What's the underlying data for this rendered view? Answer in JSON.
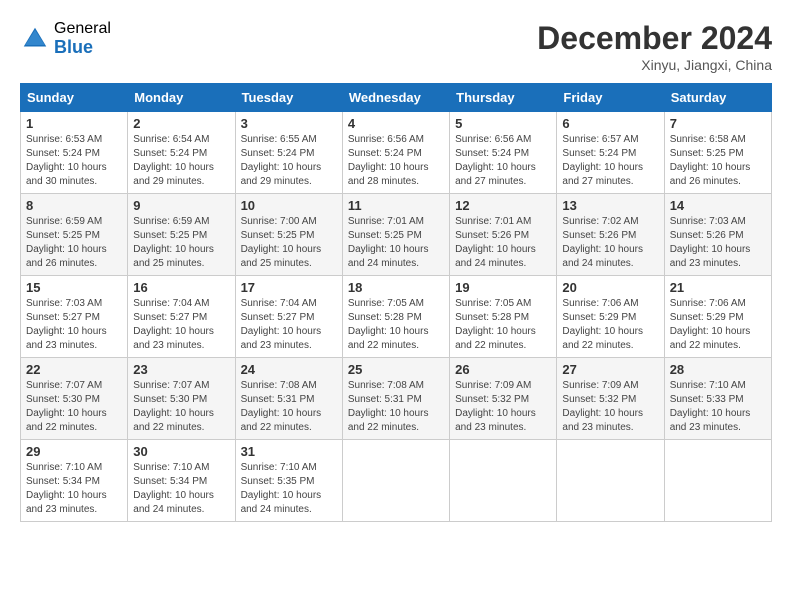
{
  "header": {
    "logo_general": "General",
    "logo_blue": "Blue",
    "title": "December 2024",
    "location": "Xinyu, Jiangxi, China"
  },
  "weekdays": [
    "Sunday",
    "Monday",
    "Tuesday",
    "Wednesday",
    "Thursday",
    "Friday",
    "Saturday"
  ],
  "weeks": [
    [
      {
        "day": "1",
        "sunrise": "6:53 AM",
        "sunset": "5:24 PM",
        "daylight": "10 hours and 30 minutes."
      },
      {
        "day": "2",
        "sunrise": "6:54 AM",
        "sunset": "5:24 PM",
        "daylight": "10 hours and 29 minutes."
      },
      {
        "day": "3",
        "sunrise": "6:55 AM",
        "sunset": "5:24 PM",
        "daylight": "10 hours and 29 minutes."
      },
      {
        "day": "4",
        "sunrise": "6:56 AM",
        "sunset": "5:24 PM",
        "daylight": "10 hours and 28 minutes."
      },
      {
        "day": "5",
        "sunrise": "6:56 AM",
        "sunset": "5:24 PM",
        "daylight": "10 hours and 27 minutes."
      },
      {
        "day": "6",
        "sunrise": "6:57 AM",
        "sunset": "5:24 PM",
        "daylight": "10 hours and 27 minutes."
      },
      {
        "day": "7",
        "sunrise": "6:58 AM",
        "sunset": "5:25 PM",
        "daylight": "10 hours and 26 minutes."
      }
    ],
    [
      {
        "day": "8",
        "sunrise": "6:59 AM",
        "sunset": "5:25 PM",
        "daylight": "10 hours and 26 minutes."
      },
      {
        "day": "9",
        "sunrise": "6:59 AM",
        "sunset": "5:25 PM",
        "daylight": "10 hours and 25 minutes."
      },
      {
        "day": "10",
        "sunrise": "7:00 AM",
        "sunset": "5:25 PM",
        "daylight": "10 hours and 25 minutes."
      },
      {
        "day": "11",
        "sunrise": "7:01 AM",
        "sunset": "5:25 PM",
        "daylight": "10 hours and 24 minutes."
      },
      {
        "day": "12",
        "sunrise": "7:01 AM",
        "sunset": "5:26 PM",
        "daylight": "10 hours and 24 minutes."
      },
      {
        "day": "13",
        "sunrise": "7:02 AM",
        "sunset": "5:26 PM",
        "daylight": "10 hours and 24 minutes."
      },
      {
        "day": "14",
        "sunrise": "7:03 AM",
        "sunset": "5:26 PM",
        "daylight": "10 hours and 23 minutes."
      }
    ],
    [
      {
        "day": "15",
        "sunrise": "7:03 AM",
        "sunset": "5:27 PM",
        "daylight": "10 hours and 23 minutes."
      },
      {
        "day": "16",
        "sunrise": "7:04 AM",
        "sunset": "5:27 PM",
        "daylight": "10 hours and 23 minutes."
      },
      {
        "day": "17",
        "sunrise": "7:04 AM",
        "sunset": "5:27 PM",
        "daylight": "10 hours and 23 minutes."
      },
      {
        "day": "18",
        "sunrise": "7:05 AM",
        "sunset": "5:28 PM",
        "daylight": "10 hours and 22 minutes."
      },
      {
        "day": "19",
        "sunrise": "7:05 AM",
        "sunset": "5:28 PM",
        "daylight": "10 hours and 22 minutes."
      },
      {
        "day": "20",
        "sunrise": "7:06 AM",
        "sunset": "5:29 PM",
        "daylight": "10 hours and 22 minutes."
      },
      {
        "day": "21",
        "sunrise": "7:06 AM",
        "sunset": "5:29 PM",
        "daylight": "10 hours and 22 minutes."
      }
    ],
    [
      {
        "day": "22",
        "sunrise": "7:07 AM",
        "sunset": "5:30 PM",
        "daylight": "10 hours and 22 minutes."
      },
      {
        "day": "23",
        "sunrise": "7:07 AM",
        "sunset": "5:30 PM",
        "daylight": "10 hours and 22 minutes."
      },
      {
        "day": "24",
        "sunrise": "7:08 AM",
        "sunset": "5:31 PM",
        "daylight": "10 hours and 22 minutes."
      },
      {
        "day": "25",
        "sunrise": "7:08 AM",
        "sunset": "5:31 PM",
        "daylight": "10 hours and 22 minutes."
      },
      {
        "day": "26",
        "sunrise": "7:09 AM",
        "sunset": "5:32 PM",
        "daylight": "10 hours and 23 minutes."
      },
      {
        "day": "27",
        "sunrise": "7:09 AM",
        "sunset": "5:32 PM",
        "daylight": "10 hours and 23 minutes."
      },
      {
        "day": "28",
        "sunrise": "7:10 AM",
        "sunset": "5:33 PM",
        "daylight": "10 hours and 23 minutes."
      }
    ],
    [
      {
        "day": "29",
        "sunrise": "7:10 AM",
        "sunset": "5:34 PM",
        "daylight": "10 hours and 23 minutes."
      },
      {
        "day": "30",
        "sunrise": "7:10 AM",
        "sunset": "5:34 PM",
        "daylight": "10 hours and 24 minutes."
      },
      {
        "day": "31",
        "sunrise": "7:10 AM",
        "sunset": "5:35 PM",
        "daylight": "10 hours and 24 minutes."
      },
      null,
      null,
      null,
      null
    ]
  ]
}
